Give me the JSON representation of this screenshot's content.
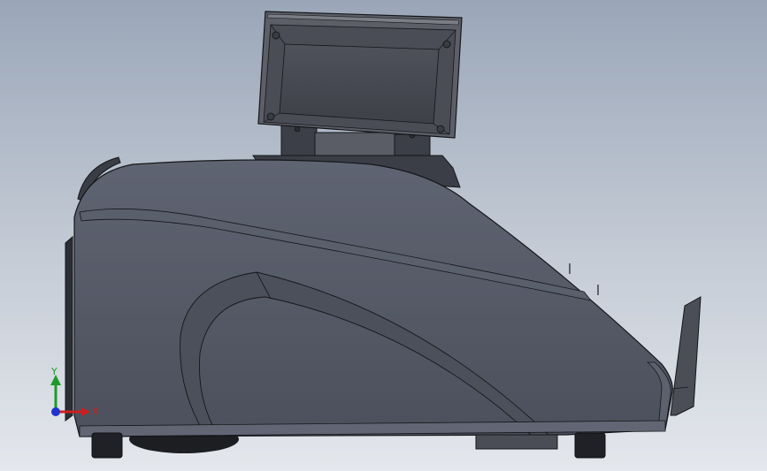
{
  "viewport": {
    "background_top": "#9aa6b8",
    "background_bottom": "#e4e7ec"
  },
  "model": {
    "body_color": "#535866",
    "edge_color": "#1a1c22",
    "display_color": "#4a4d55"
  },
  "triad": {
    "x_label": "X",
    "y_label": "Y",
    "x_color": "#cc1f1f",
    "y_color": "#1f9a2a",
    "z_color": "#1f33cc"
  }
}
